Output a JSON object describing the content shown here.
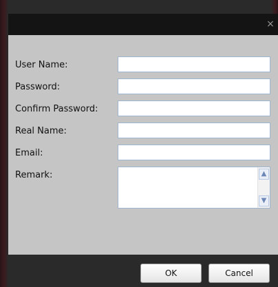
{
  "dialog": {
    "close_glyph": "×",
    "fields": [
      {
        "label": "User Name:"
      },
      {
        "label": "Password:"
      },
      {
        "label": "Confirm Password:"
      },
      {
        "label": "Real Name:"
      },
      {
        "label": "Email:"
      }
    ],
    "remark_label": "Remark:",
    "scroll_up_glyph": "▲",
    "scroll_down_glyph": "▼",
    "ok_label": "OK",
    "cancel_label": "Cancel"
  }
}
